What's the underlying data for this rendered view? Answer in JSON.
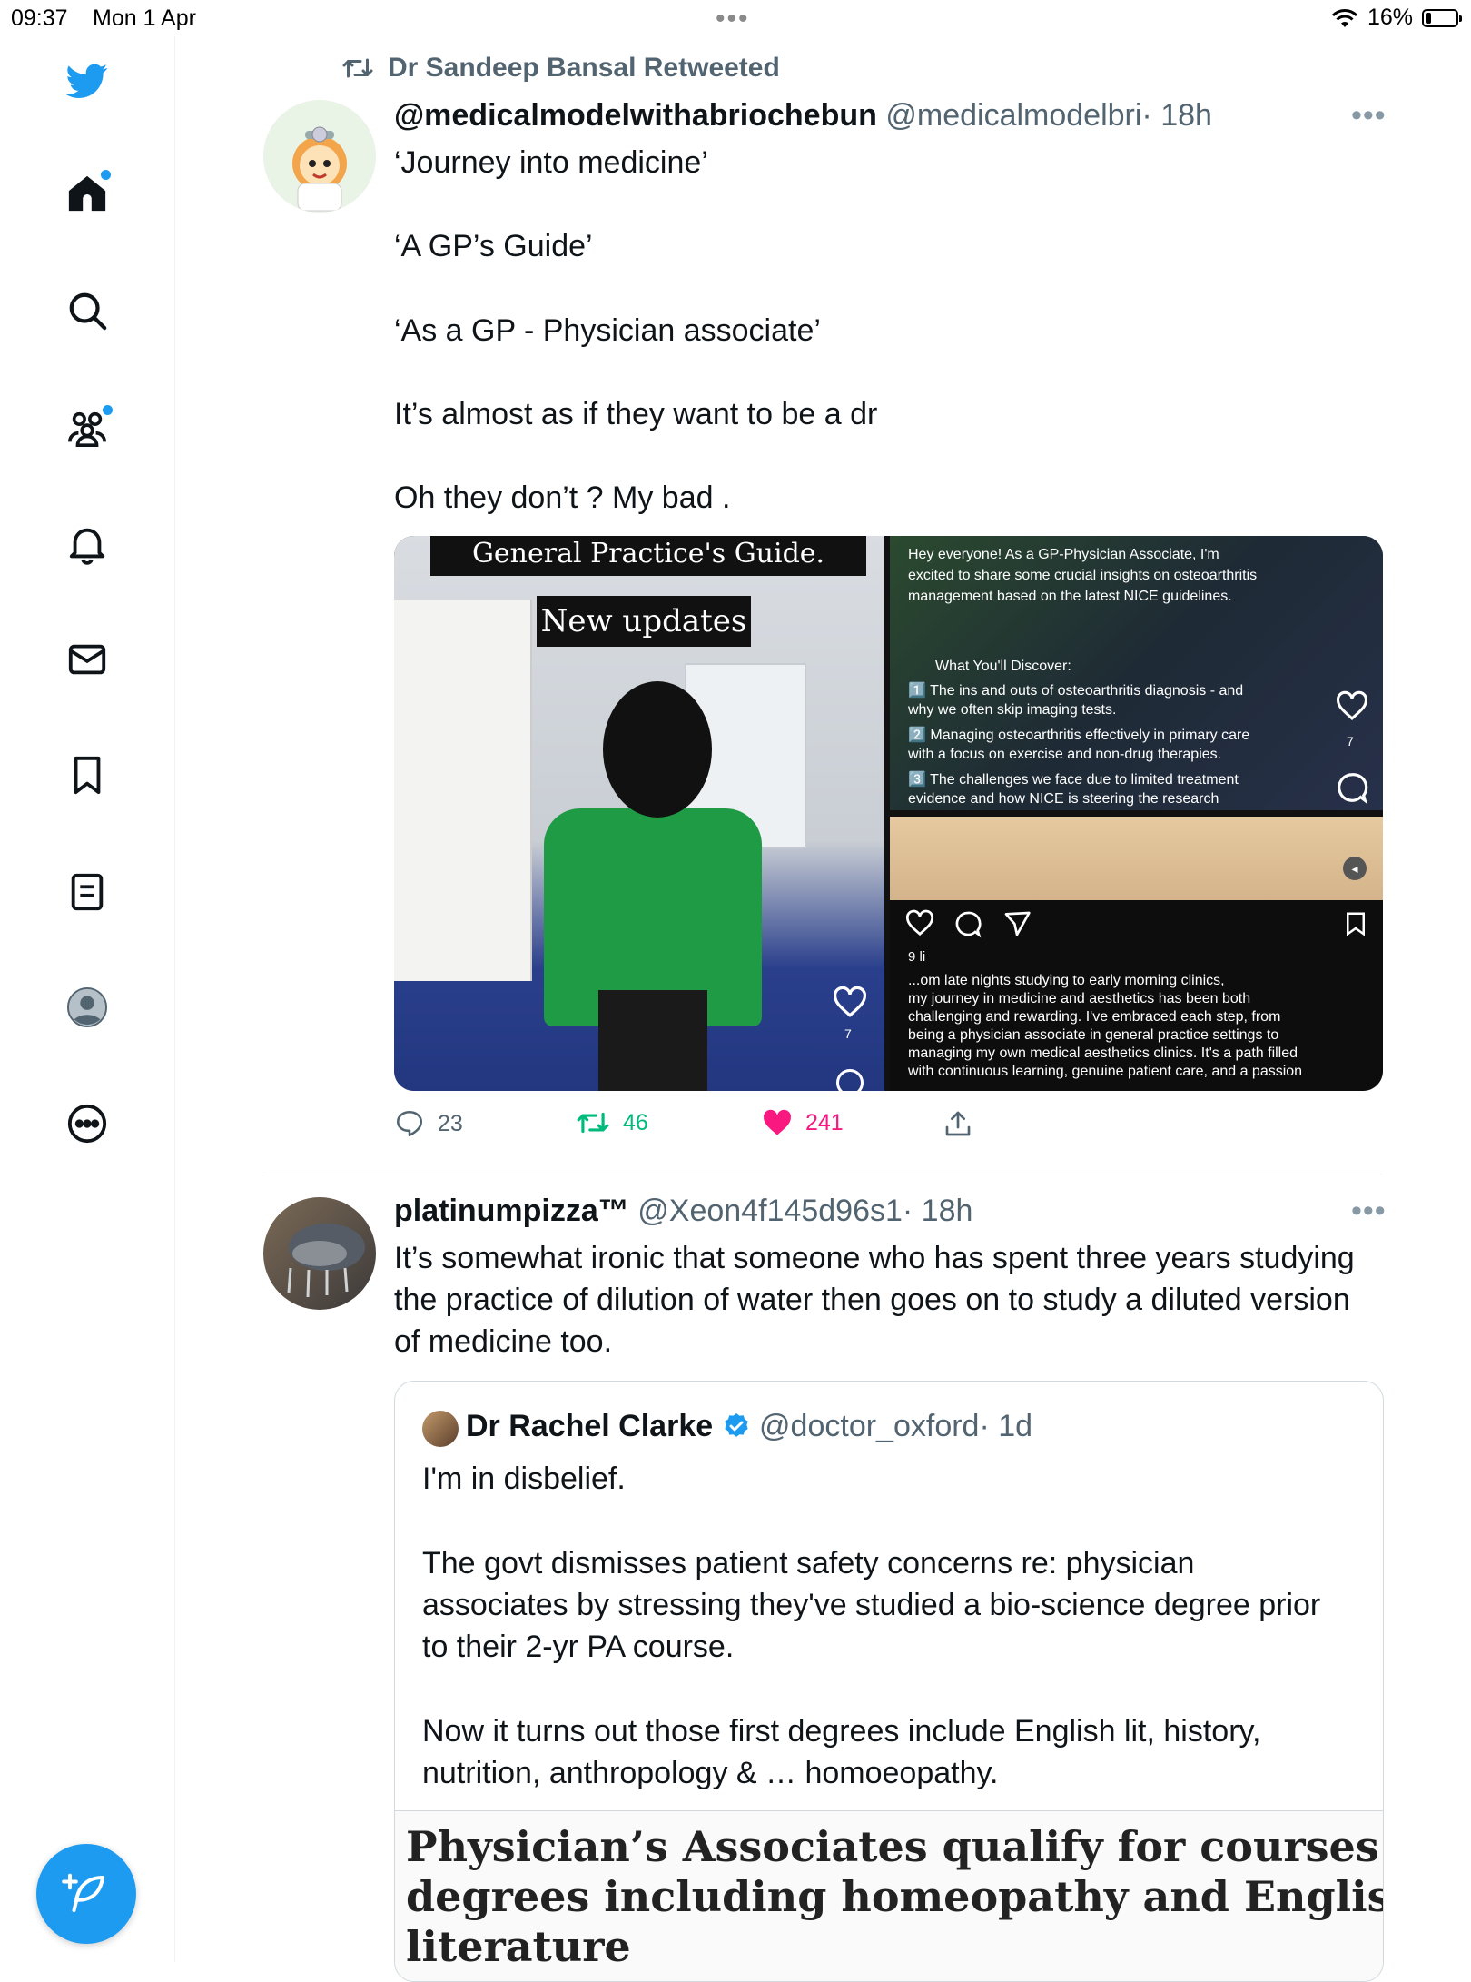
{
  "status_bar": {
    "time": "09:37",
    "date": "Mon 1 Apr",
    "battery": "16%"
  },
  "timeline": {
    "retweet_label": "Dr Sandeep Bansal Retweeted",
    "tweet1": {
      "name": "@medicalmodelwithabriochebun",
      "handle": "@medicalmodelbri",
      "time": "· 18h",
      "lines": [
        "‘Journey into medicine’",
        "‘A GP’s Guide’",
        "‘As a GP - Physician associate’",
        "It’s almost as if they want to be a dr",
        "Oh they don’t ? My bad ."
      ],
      "media": {
        "left_title": "General Practice's Guide.",
        "left_subtitle": "New updates",
        "left_like_count": "7",
        "top_right_text": [
          "Hey everyone! As a GP-Physician Associate, I'm",
          "excited to share some crucial insights on osteoarthritis",
          "management based on the latest NICE guidelines.",
          "What You'll Discover:",
          "1️⃣ The ins and outs of osteoarthritis diagnosis - and",
          "why we often skip imaging tests.",
          "2️⃣ Managing osteoarthritis effectively in primary care",
          "with a focus on exercise and non-drug therapies.",
          "3️⃣ The challenges we face due to limited treatment",
          "evidence and how NICE is steering the research"
        ],
        "top_right_like_count": "7",
        "bottom_right_likes": "9 li",
        "bottom_right_text": [
          "...om late nights studying to early morning clinics,",
          "my journey in medicine and aesthetics has been both",
          "challenging and rewarding. I've embraced each step, from",
          "being a physician associate in general practice settings to",
          "managing my own medical aesthetics clinics. It's a path filled",
          "with continuous learning, genuine patient care, and a passion"
        ]
      },
      "replies": "23",
      "retweets": "46",
      "likes": "241"
    },
    "tweet2": {
      "name": "platinumpizza™",
      "handle": "@Xeon4f145d96s1",
      "time": "· 18h",
      "lines": [
        "It’s somewhat ironic that someone who has spent three years studying",
        "the practice of dilution of water then goes on to study a diluted version",
        "of medicine too."
      ],
      "quote": {
        "name": "Dr Rachel Clarke",
        "handle": "@doctor_oxford",
        "time": "· 1d",
        "lines": [
          "I'm in disbelief.",
          "The govt dismisses patient safety concerns re: physician",
          "associates by stressing they've studied a bio-science degree prior",
          "to their 2-yr PA course.",
          "Now it turns out those first degrees include English lit, history,",
          "nutrition, anthropology & … homoeopathy."
        ],
        "headline_lines": [
          "Physician’s Associates qualify for courses with",
          "degrees including homeopathy and English",
          "literature"
        ]
      }
    }
  }
}
